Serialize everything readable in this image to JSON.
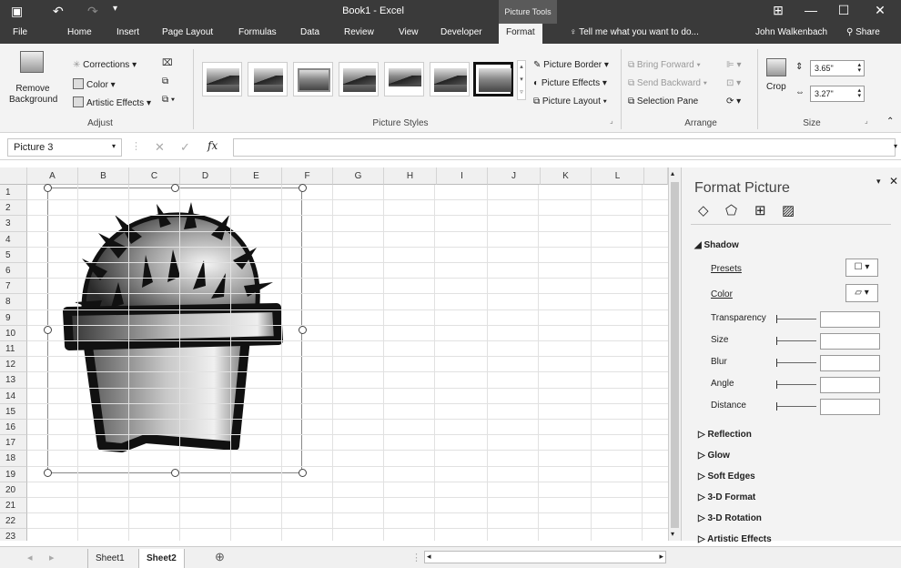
{
  "window": {
    "title": "Book1 - Excel",
    "context_label": "Picture Tools",
    "user": "John Walkenbach",
    "share_label": "Share"
  },
  "tabs": [
    "File",
    "Home",
    "Insert",
    "Page Layout",
    "Formulas",
    "Data",
    "Review",
    "View",
    "Developer",
    "Format"
  ],
  "active_tab": "Format",
  "tell_me": "Tell me what you want to do...",
  "ribbon": {
    "adjust": {
      "remove_bg": "Remove Background",
      "corrections": "Corrections",
      "color": "Color",
      "artistic": "Artistic Effects",
      "label": "Adjust"
    },
    "picture_styles": {
      "border": "Picture Border",
      "effects": "Picture Effects",
      "layout": "Picture Layout",
      "label": "Picture Styles"
    },
    "arrange": {
      "bring_forward": "Bring Forward",
      "send_backward": "Send Backward",
      "selection_pane": "Selection Pane",
      "label": "Arrange"
    },
    "size": {
      "crop": "Crop",
      "height": "3.65\"",
      "width": "3.27\"",
      "label": "Size"
    }
  },
  "formula_bar": {
    "name_box": "Picture 3",
    "fx": "fx",
    "value": ""
  },
  "columns": [
    "A",
    "B",
    "C",
    "D",
    "E",
    "F",
    "G",
    "H",
    "I",
    "J",
    "K",
    "L"
  ],
  "rows": [
    "1",
    "2",
    "3",
    "4",
    "5",
    "6",
    "7",
    "8",
    "9",
    "10",
    "11",
    "12",
    "13",
    "14",
    "15",
    "16",
    "17",
    "18",
    "19",
    "20",
    "21",
    "22",
    "23"
  ],
  "pane": {
    "title": "Format Picture",
    "shadow": "Shadow",
    "presets": "Presets",
    "color": "Color",
    "transparency": "Transparency",
    "size": "Size",
    "blur": "Blur",
    "angle": "Angle",
    "distance": "Distance",
    "reflection": "Reflection",
    "glow": "Glow",
    "soft_edges": "Soft Edges",
    "format_3d": "3-D Format",
    "rotation_3d": "3-D Rotation",
    "artistic": "Artistic Effects"
  },
  "sheets": [
    "Sheet1",
    "Sheet2"
  ],
  "active_sheet": "Sheet2"
}
